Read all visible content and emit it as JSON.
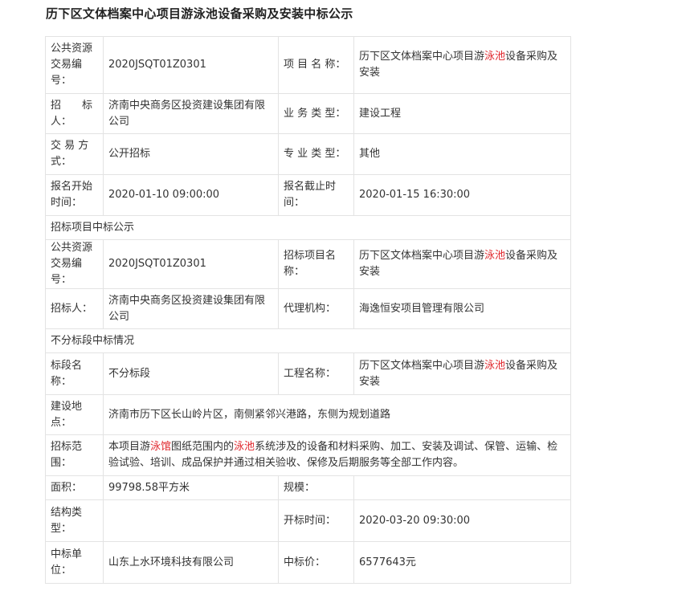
{
  "page_title": "历下区文体档案中心项目游泳池设备采购及安装中标公示",
  "project_name_parts": [
    "历下区文体档案中心项目游",
    "泳池",
    "设备采购及安装"
  ],
  "rows": {
    "r1": {
      "l1": "公共资源交易编号：",
      "v1": "2020JSQT01Z0301",
      "l2": "项 目 名 称："
    },
    "r2": {
      "l1": "招　　标人：",
      "v1": "济南中央商务区投资建设集团有限公司",
      "l2": "业 务 类 型：",
      "v2": "建设工程"
    },
    "r3": {
      "l1": "交 易 方式：",
      "v1": "公开招标",
      "l2": "专 业 类 型：",
      "v2": "其他"
    },
    "r4": {
      "l1": "报名开始时间：",
      "v1": "2020-01-10 09:00:00",
      "l2": "报名截止时间：",
      "v2": "2020-01-15 16:30:00"
    },
    "s1": "招标项目中标公示",
    "r5": {
      "l1": "公共资源交易编号：",
      "v1": "2020JSQT01Z0301",
      "l2": "招标项目名称："
    },
    "r6": {
      "l1": "招标人：",
      "v1": "济南中央商务区投资建设集团有限公司",
      "l2": "代理机构：",
      "v2": "海逸恒安项目管理有限公司"
    },
    "s2": "不分标段中标情况",
    "r7": {
      "l1": "标段名称：",
      "v1": "不分标段",
      "l2": "工程名称："
    },
    "r8": {
      "l1": "建设地点：",
      "v1": "济南市历下区长山岭片区，南侧紧邻兴港路，东侧为规划道路"
    },
    "r9": {
      "l1": "招标范围：",
      "v_parts": [
        "本项目游",
        "泳馆",
        "图纸范围内的",
        "泳池",
        "系统涉及的设备和材料采购、加工、安装及调试、保管、运输、检验试验、培训、成品保护并通过相关验收、保修及后期服务等全部工作内容。"
      ]
    },
    "r10": {
      "l1": "面积：",
      "v1": "99798.58平方米",
      "l2": "规模：",
      "v2": ""
    },
    "r11": {
      "l1": "结构类型：",
      "v1": "",
      "l2": "开标时间：",
      "v2": "2020-03-20 09:30:00"
    },
    "r12": {
      "l1": "中标单位：",
      "v1": "山东上水环境科技有限公司",
      "l2": "中标价：",
      "v2": "6577643元"
    }
  },
  "colors": {
    "highlight": "#e0262b",
    "border": "#e3e3e3"
  }
}
